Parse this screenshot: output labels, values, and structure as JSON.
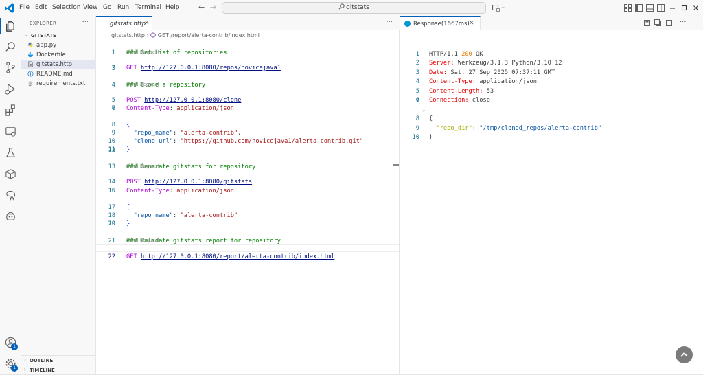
{
  "titlebar": {
    "menus": [
      "File",
      "Edit",
      "Selection",
      "View",
      "Go",
      "Run",
      "Terminal",
      "Help"
    ],
    "search_text": "gitstats",
    "accent_color": "#007acc"
  },
  "activity": {
    "accounts_badge": "1",
    "settings_badge": "1"
  },
  "explorer": {
    "title": "EXPLORER",
    "more": "···",
    "folder": "GITSTATS",
    "files": [
      {
        "name": "app.py",
        "icon": "python-icon"
      },
      {
        "name": "Dockerfile",
        "icon": "docker-icon"
      },
      {
        "name": "gitstats.http",
        "icon": "http-file-icon"
      },
      {
        "name": "README.md",
        "icon": "info-icon"
      },
      {
        "name": "requirements.txt",
        "icon": "text-file-icon"
      }
    ],
    "outline_label": "OUTLINE",
    "timeline_label": "TIMELINE"
  },
  "editor": {
    "tab_label": "gitstats.http",
    "more": "···",
    "breadcrumb_file": "gitstats.http",
    "breadcrumb_sep": "›",
    "breadcrumb_symbol": "GET /report/alerta-contrib/index.html",
    "send_request_label": "Send Request",
    "current_line": "22",
    "lines": {
      "l1_comment": "### Get List of repositories",
      "l2_method": "GET",
      "l2_url": "http://127.0.0.1:8080/repos/novicejava1",
      "l4_comment": "### Clone a repository",
      "l5_method": "POST",
      "l5_url": "http://127.0.0.1:8080/clone",
      "l6_hkey": "Content-Type",
      "l6_colon": ":",
      "l6_hval": " application/json",
      "l8_brace": "{",
      "l9_key": "\"repo_name\"",
      "l9_colon": ": ",
      "l9_val": "\"alerta-contrib\"",
      "l9_comma": ",",
      "l10_key": "\"clone_url\"",
      "l10_colon": ": ",
      "l10_val": "\"https://github.com/novicejava1/alerta-contrib.git\"",
      "l11_brace": "}",
      "l13_comment": "### Generate gitstats for repository",
      "l14_method": "POST",
      "l14_url": "http://127.0.0.1:8080/gitstats",
      "l15_hkey": "Content-Type",
      "l15_colon": ":",
      "l15_hval": " application/json",
      "l17_brace": "{",
      "l18_key": "\"repo_name\"",
      "l18_colon": ": ",
      "l18_val": "\"alerta-contrib\"",
      "l19_brace": "}",
      "l21_comment": "### Validate gitstats report for repository",
      "l22_method": "GET",
      "l22_url": "http://127.0.0.1:8080/report/alerta-contrib/index.html"
    }
  },
  "response": {
    "tab_label": "Response(1667ms)",
    "lines": {
      "r1_proto": "HTTP/1.1 ",
      "r1_code": "200",
      "r1_text": " OK",
      "r2_name": "Server",
      "r2_val": "Werkzeug/3.1.3 Python/3.10.12",
      "r3_name": "Date",
      "r3_val": "Sat, 27 Sep 2025 07:37:11 GMT",
      "r4_name": "Content-Type",
      "r4_val": "application/json",
      "r5_name": "Content-Length",
      "r5_val": "53",
      "r6_name": "Connection",
      "r6_val": "close",
      "r8_brace": "{",
      "r9_key": "\"repo_dir\"",
      "r9_colon": ": ",
      "r9_val": "\"/tmp/cloned_repos/alerta-contrib\"",
      "r10_brace": "}"
    }
  }
}
